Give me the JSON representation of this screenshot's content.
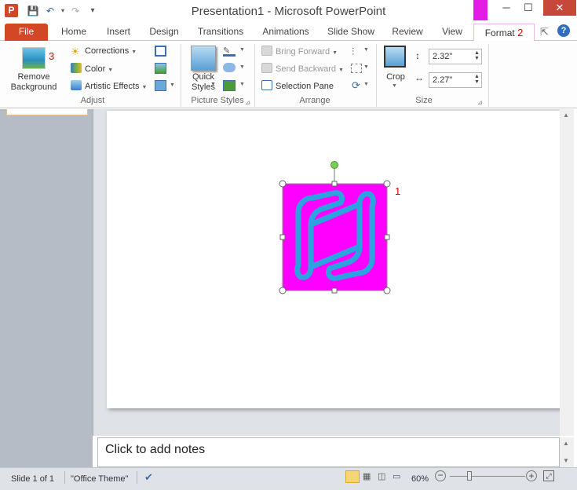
{
  "app": {
    "icon_letter": "P",
    "title": "Presentation1  -  Microsoft PowerPoint"
  },
  "qat": {
    "save": "💾",
    "undo": "↶",
    "redo": "↷",
    "customize": "▾"
  },
  "window": {
    "minimize": "─",
    "maximize": "☐",
    "close": "✕"
  },
  "tabs": [
    "File",
    "Home",
    "Insert",
    "Design",
    "Transitions",
    "Animations",
    "Slide Show",
    "Review",
    "View",
    "Format"
  ],
  "format_badge": "2",
  "ribbon": {
    "remove_background": "Remove\nBackground",
    "remove_badge": "3",
    "corrections": "Corrections",
    "color": "Color",
    "artistic_effects": "Artistic Effects",
    "adjust_label": "Adjust",
    "quick_styles": "Quick\nStyles",
    "picture_styles_label": "Picture Styles",
    "bring_forward": "Bring Forward",
    "send_backward": "Send Backward",
    "selection_pane": "Selection Pane",
    "arrange_label": "Arrange",
    "crop": "Crop",
    "height": "2.32\"",
    "width": "2.27\"",
    "size_label": "Size"
  },
  "slide": {
    "image_badge": "1",
    "image_bg": "#ff00ff",
    "icon_color": "#2aa3df"
  },
  "notes": {
    "placeholder": "Click to add notes"
  },
  "status": {
    "slide": "Slide 1 of 1",
    "theme": "\"Office Theme\"",
    "zoom": "60%"
  },
  "colors": {
    "file_tab": "#d24726",
    "picture_tools": "#e31ce6"
  }
}
